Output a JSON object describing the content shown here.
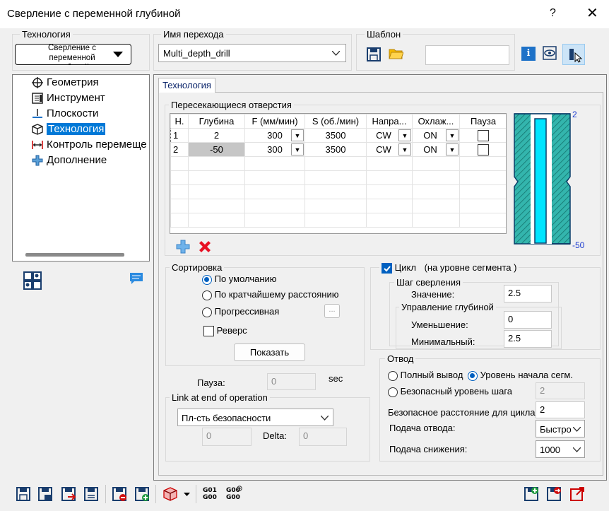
{
  "window": {
    "title": "Сверление с переменной глубиной",
    "help": "?",
    "close": "✕"
  },
  "technology_box": {
    "label": "Технология",
    "button_text": "Сверление с переменной глубиной"
  },
  "transition": {
    "label": "Имя перехода",
    "value": "Multi_depth_drill"
  },
  "template": {
    "label": "Шаблон",
    "field_value": ""
  },
  "tree": {
    "items": [
      {
        "label": "Геометрия",
        "icon": "crosshair-icon"
      },
      {
        "label": "Инструмент",
        "icon": "tool-icon"
      },
      {
        "label": "Плоскости",
        "icon": "plane-icon"
      },
      {
        "label": "Технология",
        "icon": "cube-icon",
        "selected": true
      },
      {
        "label": "Контроль перемеще",
        "icon": "move-control-icon"
      },
      {
        "label": "Дополнение",
        "icon": "plus-icon"
      }
    ]
  },
  "tab": {
    "label": "Технология"
  },
  "holes": {
    "label": "Пересекающиеся отверстия",
    "columns": [
      "Н.",
      "Глубина",
      "F (мм/мин)",
      "S (об./мин)",
      "Напра...",
      "Охлаж...",
      "Пауза"
    ],
    "rows": [
      {
        "n": "1",
        "depth": "2",
        "f": "300",
        "s": "3500",
        "dir": "CW",
        "cool": "ON",
        "pause": false
      },
      {
        "n": "2",
        "depth": "-50",
        "f": "300",
        "s": "3500",
        "dir": "CW",
        "cool": "ON",
        "pause": false
      }
    ],
    "preview_top": "2",
    "preview_bottom": "-50"
  },
  "sort": {
    "label": "Сортировка",
    "options": [
      "По умолчанию",
      "По кратчайшему расстоянию",
      "Прогрессивная"
    ],
    "selected_index": 0,
    "more": "...",
    "reverse_label": "Реверс",
    "show_button": "Показать"
  },
  "pause": {
    "label": "Пауза:",
    "value": "0",
    "unit": "sec"
  },
  "link": {
    "label": "Link at end of operation",
    "value": "Пл-сть безопасности",
    "field1": "0",
    "delta_label": "Delta:",
    "delta_value": "0"
  },
  "cycle": {
    "checkbox_label": "Цикл",
    "note": "(на уровне сегмента )",
    "step_label": "Шаг сверления",
    "value_label": "Значение:",
    "value": "2.5",
    "depth_control_label": "Управление глубиной",
    "decrease_label": "Уменьшение:",
    "decrease_value": "0",
    "min_label": "Минимальный:",
    "min_value": "2.5"
  },
  "retract": {
    "label": "Отвод",
    "full_label": "Полный вывод",
    "segment_label": "Уровень начала сегм.",
    "safe_label": "Безопасный уровень шага",
    "safe_value": "2",
    "safe_dist_label": "Безопасное расстояние для цикла:",
    "safe_dist_value": "2",
    "retract_feed_label": "Подача отвода:",
    "retract_feed_value": "Быстро",
    "plunge_feed_label": "Подача снижения:",
    "plunge_feed_value": "1000"
  },
  "bottom_toolbar": {
    "g01_line1": "G01",
    "g01_line2": "G00",
    "g00_line1": "G00",
    "g00_line2": "G00"
  },
  "colors": {
    "accent": "#0078d7",
    "hatch": "#2aa9a0",
    "cyan": "#00e5ff",
    "delete_red": "#e81123",
    "add_blue": "#4a9fe0"
  }
}
